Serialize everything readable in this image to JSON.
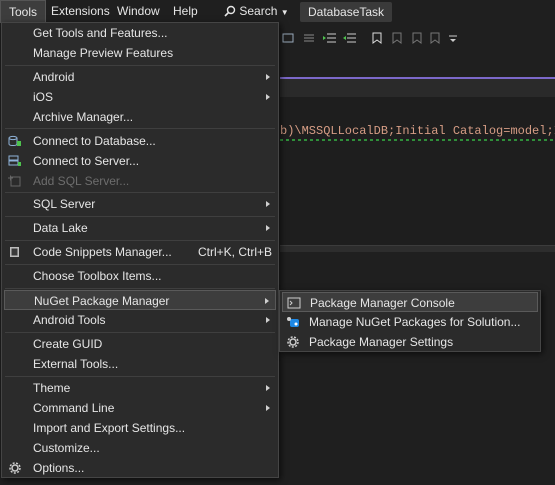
{
  "menubar": {
    "items": [
      "Tools",
      "Extensions",
      "Window",
      "Help"
    ],
    "search_label": "Search",
    "task_tab": "DatabaseTask"
  },
  "editor": {
    "connection_text": "b)\\MSSQLLocalDB;Initial Catalog=model;Integrat"
  },
  "tools_menu": {
    "items": [
      {
        "label": "Get Tools and Features..."
      },
      {
        "label": "Manage Preview Features"
      },
      {
        "label": "Android"
      },
      {
        "label": "iOS"
      },
      {
        "label": "Archive Manager..."
      },
      {
        "label": "Connect to Database..."
      },
      {
        "label": "Connect to Server..."
      },
      {
        "label": "Add SQL Server..."
      },
      {
        "label": "SQL Server"
      },
      {
        "label": "Data Lake"
      },
      {
        "label": "Code Snippets Manager...",
        "shortcut": "Ctrl+K, Ctrl+B"
      },
      {
        "label": "Choose Toolbox Items..."
      },
      {
        "label": "NuGet Package Manager"
      },
      {
        "label": "Android Tools"
      },
      {
        "label": "Create GUID"
      },
      {
        "label": "External Tools..."
      },
      {
        "label": "Theme"
      },
      {
        "label": "Command Line"
      },
      {
        "label": "Import and Export Settings..."
      },
      {
        "label": "Customize..."
      },
      {
        "label": "Options..."
      }
    ]
  },
  "nuget_submenu": {
    "items": [
      {
        "label": "Package Manager Console"
      },
      {
        "label": "Manage NuGet Packages for Solution..."
      },
      {
        "label": "Package Manager Settings"
      }
    ]
  },
  "colors": {
    "accent": "#7b68c9",
    "menu_bg": "#2b2b2b",
    "highlight_bg": "#3d3d3d",
    "disabled_text": "#6d6d6d"
  }
}
